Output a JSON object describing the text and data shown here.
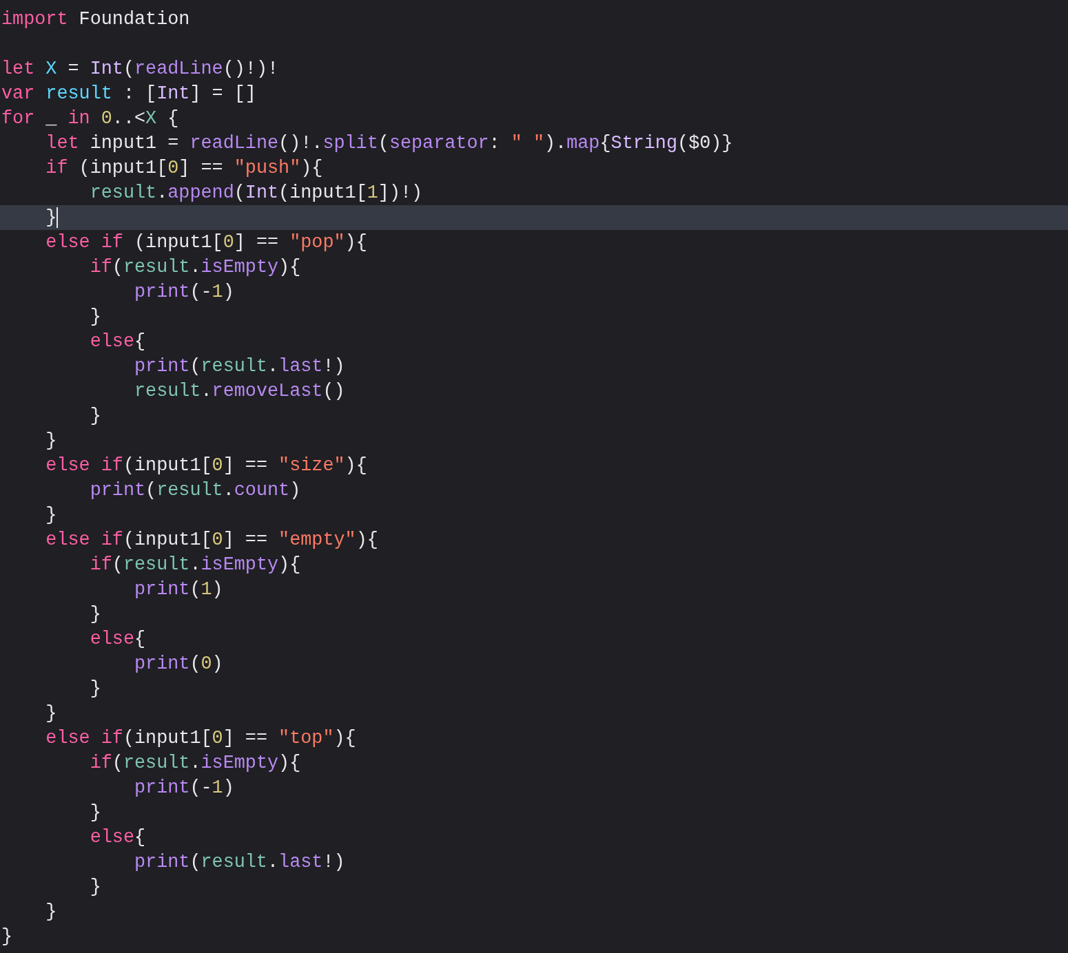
{
  "editor": {
    "lines": [
      {
        "current": false,
        "tokens": [
          {
            "kind": "keyword",
            "text": "import"
          },
          {
            "kind": "plain",
            "text": " Foundation"
          }
        ]
      },
      {
        "current": false
      },
      {
        "current": false,
        "tokens": [
          {
            "kind": "keyword",
            "text": "let"
          },
          {
            "kind": "decl",
            "text": " X"
          },
          {
            "kind": "plain",
            "text": " = "
          },
          {
            "kind": "type",
            "text": "Int"
          },
          {
            "kind": "plain",
            "text": "("
          },
          {
            "kind": "func",
            "text": "readLine"
          },
          {
            "kind": "plain",
            "text": "()!)!"
          }
        ]
      },
      {
        "current": false,
        "tokens": [
          {
            "kind": "keyword",
            "text": "var"
          },
          {
            "kind": "decl",
            "text": " result"
          },
          {
            "kind": "plain",
            "text": " : ["
          },
          {
            "kind": "type",
            "text": "Int"
          },
          {
            "kind": "plain",
            "text": "] = []"
          }
        ]
      },
      {
        "current": false,
        "tokens": [
          {
            "kind": "keyword",
            "text": "for"
          },
          {
            "kind": "plain",
            "text": " _ "
          },
          {
            "kind": "keyword",
            "text": "in"
          },
          {
            "kind": "number",
            "text": " 0"
          },
          {
            "kind": "plain",
            "text": "..<"
          },
          {
            "kind": "project",
            "text": "X"
          },
          {
            "kind": "plain",
            "text": " {"
          }
        ]
      },
      {
        "current": false,
        "tokens": [
          {
            "kind": "keyword",
            "text": "    let"
          },
          {
            "kind": "plain",
            "text": " input1 = "
          },
          {
            "kind": "func",
            "text": "readLine"
          },
          {
            "kind": "plain",
            "text": "()!."
          },
          {
            "kind": "func",
            "text": "split"
          },
          {
            "kind": "plain",
            "text": "("
          },
          {
            "kind": "func",
            "text": "separator"
          },
          {
            "kind": "plain",
            "text": ": "
          },
          {
            "kind": "string",
            "text": "\" \""
          },
          {
            "kind": "plain",
            "text": ")."
          },
          {
            "kind": "func",
            "text": "map"
          },
          {
            "kind": "plain",
            "text": "{"
          },
          {
            "kind": "type",
            "text": "String"
          },
          {
            "kind": "plain",
            "text": "($0)}"
          }
        ]
      },
      {
        "current": false,
        "tokens": [
          {
            "kind": "keyword",
            "text": "    if"
          },
          {
            "kind": "plain",
            "text": " (input1["
          },
          {
            "kind": "number",
            "text": "0"
          },
          {
            "kind": "plain",
            "text": "] == "
          },
          {
            "kind": "string",
            "text": "\"push\""
          },
          {
            "kind": "plain",
            "text": "){"
          }
        ]
      },
      {
        "current": false,
        "tokens": [
          {
            "kind": "project",
            "text": "        result"
          },
          {
            "kind": "plain",
            "text": "."
          },
          {
            "kind": "func",
            "text": "append"
          },
          {
            "kind": "plain",
            "text": "("
          },
          {
            "kind": "type",
            "text": "Int"
          },
          {
            "kind": "plain",
            "text": "(input1["
          },
          {
            "kind": "number",
            "text": "1"
          },
          {
            "kind": "plain",
            "text": "])!)"
          }
        ]
      },
      {
        "current": true,
        "tokens": [
          {
            "kind": "plain",
            "text": "    }"
          }
        ]
      },
      {
        "current": false,
        "tokens": [
          {
            "kind": "keyword",
            "text": "    else"
          },
          {
            "kind": "keyword",
            "text": " if"
          },
          {
            "kind": "plain",
            "text": " (input1["
          },
          {
            "kind": "number",
            "text": "0"
          },
          {
            "kind": "plain",
            "text": "] == "
          },
          {
            "kind": "string",
            "text": "\"pop\""
          },
          {
            "kind": "plain",
            "text": "){"
          }
        ]
      },
      {
        "current": false,
        "tokens": [
          {
            "kind": "keyword",
            "text": "        if"
          },
          {
            "kind": "plain",
            "text": "("
          },
          {
            "kind": "project",
            "text": "result"
          },
          {
            "kind": "plain",
            "text": "."
          },
          {
            "kind": "func",
            "text": "isEmpty"
          },
          {
            "kind": "plain",
            "text": "){"
          }
        ]
      },
      {
        "current": false,
        "tokens": [
          {
            "kind": "func",
            "text": "            print"
          },
          {
            "kind": "plain",
            "text": "(-"
          },
          {
            "kind": "number",
            "text": "1"
          },
          {
            "kind": "plain",
            "text": ")"
          }
        ]
      },
      {
        "current": false,
        "tokens": [
          {
            "kind": "plain",
            "text": "        }"
          }
        ]
      },
      {
        "current": false,
        "tokens": [
          {
            "kind": "keyword",
            "text": "        else"
          },
          {
            "kind": "plain",
            "text": "{"
          }
        ]
      },
      {
        "current": false,
        "tokens": [
          {
            "kind": "func",
            "text": "            print"
          },
          {
            "kind": "plain",
            "text": "("
          },
          {
            "kind": "project",
            "text": "result"
          },
          {
            "kind": "plain",
            "text": "."
          },
          {
            "kind": "func",
            "text": "last"
          },
          {
            "kind": "plain",
            "text": "!)"
          }
        ]
      },
      {
        "current": false,
        "tokens": [
          {
            "kind": "project",
            "text": "            result"
          },
          {
            "kind": "plain",
            "text": "."
          },
          {
            "kind": "func",
            "text": "removeLast"
          },
          {
            "kind": "plain",
            "text": "()"
          }
        ]
      },
      {
        "current": false,
        "tokens": [
          {
            "kind": "plain",
            "text": "        }"
          }
        ]
      },
      {
        "current": false,
        "tokens": [
          {
            "kind": "plain",
            "text": "    }"
          }
        ]
      },
      {
        "current": false,
        "tokens": [
          {
            "kind": "keyword",
            "text": "    else"
          },
          {
            "kind": "keyword",
            "text": " if"
          },
          {
            "kind": "plain",
            "text": "(input1["
          },
          {
            "kind": "number",
            "text": "0"
          },
          {
            "kind": "plain",
            "text": "] == "
          },
          {
            "kind": "string",
            "text": "\"size\""
          },
          {
            "kind": "plain",
            "text": "){"
          }
        ]
      },
      {
        "current": false,
        "tokens": [
          {
            "kind": "func",
            "text": "        print"
          },
          {
            "kind": "plain",
            "text": "("
          },
          {
            "kind": "project",
            "text": "result"
          },
          {
            "kind": "plain",
            "text": "."
          },
          {
            "kind": "func",
            "text": "count"
          },
          {
            "kind": "plain",
            "text": ")"
          }
        ]
      },
      {
        "current": false,
        "tokens": [
          {
            "kind": "plain",
            "text": "    }"
          }
        ]
      },
      {
        "current": false,
        "tokens": [
          {
            "kind": "keyword",
            "text": "    else"
          },
          {
            "kind": "keyword",
            "text": " if"
          },
          {
            "kind": "plain",
            "text": "(input1["
          },
          {
            "kind": "number",
            "text": "0"
          },
          {
            "kind": "plain",
            "text": "] == "
          },
          {
            "kind": "string",
            "text": "\"empty\""
          },
          {
            "kind": "plain",
            "text": "){"
          }
        ]
      },
      {
        "current": false,
        "tokens": [
          {
            "kind": "keyword",
            "text": "        if"
          },
          {
            "kind": "plain",
            "text": "("
          },
          {
            "kind": "project",
            "text": "result"
          },
          {
            "kind": "plain",
            "text": "."
          },
          {
            "kind": "func",
            "text": "isEmpty"
          },
          {
            "kind": "plain",
            "text": "){"
          }
        ]
      },
      {
        "current": false,
        "tokens": [
          {
            "kind": "func",
            "text": "            print"
          },
          {
            "kind": "plain",
            "text": "("
          },
          {
            "kind": "number",
            "text": "1"
          },
          {
            "kind": "plain",
            "text": ")"
          }
        ]
      },
      {
        "current": false,
        "tokens": [
          {
            "kind": "plain",
            "text": "        }"
          }
        ]
      },
      {
        "current": false,
        "tokens": [
          {
            "kind": "keyword",
            "text": "        else"
          },
          {
            "kind": "plain",
            "text": "{"
          }
        ]
      },
      {
        "current": false,
        "tokens": [
          {
            "kind": "func",
            "text": "            print"
          },
          {
            "kind": "plain",
            "text": "("
          },
          {
            "kind": "number",
            "text": "0"
          },
          {
            "kind": "plain",
            "text": ")"
          }
        ]
      },
      {
        "current": false,
        "tokens": [
          {
            "kind": "plain",
            "text": "        }"
          }
        ]
      },
      {
        "current": false,
        "tokens": [
          {
            "kind": "plain",
            "text": "    }"
          }
        ]
      },
      {
        "current": false,
        "tokens": [
          {
            "kind": "keyword",
            "text": "    else"
          },
          {
            "kind": "keyword",
            "text": " if"
          },
          {
            "kind": "plain",
            "text": "(input1["
          },
          {
            "kind": "number",
            "text": "0"
          },
          {
            "kind": "plain",
            "text": "] == "
          },
          {
            "kind": "string",
            "text": "\"top\""
          },
          {
            "kind": "plain",
            "text": "){"
          }
        ]
      },
      {
        "current": false,
        "tokens": [
          {
            "kind": "keyword",
            "text": "        if"
          },
          {
            "kind": "plain",
            "text": "("
          },
          {
            "kind": "project",
            "text": "result"
          },
          {
            "kind": "plain",
            "text": "."
          },
          {
            "kind": "func",
            "text": "isEmpty"
          },
          {
            "kind": "plain",
            "text": "){"
          }
        ]
      },
      {
        "current": false,
        "tokens": [
          {
            "kind": "func",
            "text": "            print"
          },
          {
            "kind": "plain",
            "text": "(-"
          },
          {
            "kind": "number",
            "text": "1"
          },
          {
            "kind": "plain",
            "text": ")"
          }
        ]
      },
      {
        "current": false,
        "tokens": [
          {
            "kind": "plain",
            "text": "        }"
          }
        ]
      },
      {
        "current": false,
        "tokens": [
          {
            "kind": "keyword",
            "text": "        else"
          },
          {
            "kind": "plain",
            "text": "{"
          }
        ]
      },
      {
        "current": false,
        "tokens": [
          {
            "kind": "func",
            "text": "            print"
          },
          {
            "kind": "plain",
            "text": "("
          },
          {
            "kind": "project",
            "text": "result"
          },
          {
            "kind": "plain",
            "text": "."
          },
          {
            "kind": "func",
            "text": "last"
          },
          {
            "kind": "plain",
            "text": "!)"
          }
        ]
      },
      {
        "current": false,
        "tokens": [
          {
            "kind": "plain",
            "text": "        }"
          }
        ]
      },
      {
        "current": false,
        "tokens": [
          {
            "kind": "plain",
            "text": "    }"
          }
        ]
      },
      {
        "current": false,
        "tokens": [
          {
            "kind": "plain",
            "text": "}"
          }
        ]
      }
    ]
  }
}
